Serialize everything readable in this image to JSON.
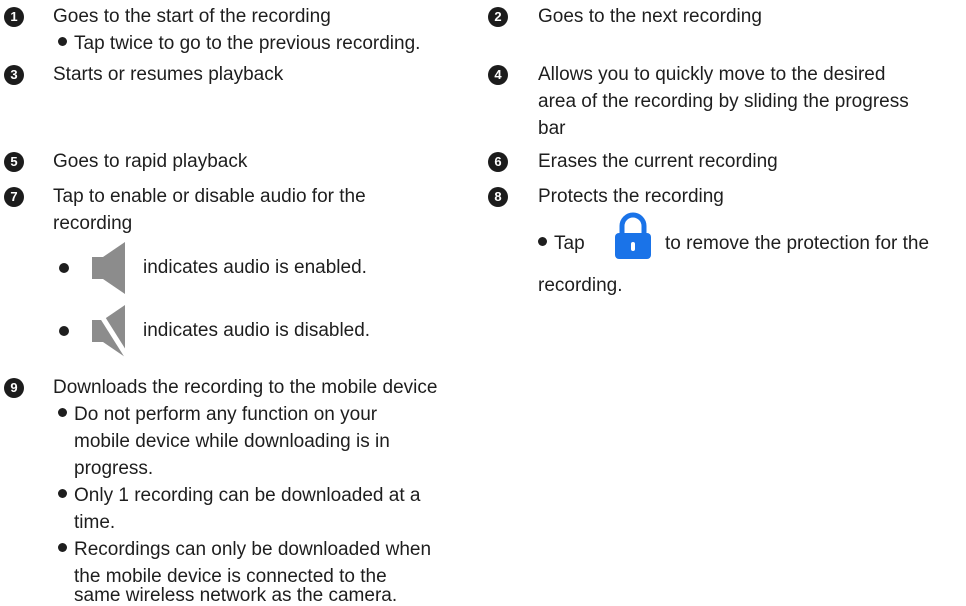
{
  "items": {
    "i1": {
      "num": "1",
      "text": "Goes to the start of the recording",
      "sub": "Tap twice to go to the previous recording."
    },
    "i2": {
      "num": "2",
      "text": "Goes to the next recording"
    },
    "i3": {
      "num": "3",
      "text": "Starts or resumes playback"
    },
    "i4": {
      "num": "4",
      "line1": "Allows you to quickly move to the desired",
      "line2": "area of the recording by sliding the progress",
      "line3": "bar"
    },
    "i5": {
      "num": "5",
      "text": "Goes to rapid playback"
    },
    "i6": {
      "num": "6",
      "text": "Erases the current recording"
    },
    "i7": {
      "num": "7",
      "line1": "Tap to enable or disable audio for the",
      "line2": "recording",
      "enabled": "indicates audio is enabled.",
      "disabled": "indicates audio is disabled."
    },
    "i8": {
      "num": "8",
      "text": "Protects the recording",
      "tap": "Tap",
      "tap_rest": "to remove the protection for the",
      "tap_line2": "recording."
    },
    "i9": {
      "num": "9",
      "text": "Downloads the recording to the mobile device",
      "b1": [
        "Do not perform any function on your",
        "mobile device while downloading is in",
        "progress."
      ],
      "b2": [
        "Only 1 recording can be downloaded at a",
        "time."
      ],
      "b3": [
        "Recordings can only be downloaded when",
        "the mobile device is connected to the",
        "same wireless network as the camera."
      ]
    }
  },
  "icons": {
    "speaker": "speaker-icon",
    "speaker_muted": "speaker-muted-icon",
    "lock": "lock-icon"
  },
  "colors": {
    "lock": "#1a73e8",
    "speaker": "#8c8c8c"
  }
}
